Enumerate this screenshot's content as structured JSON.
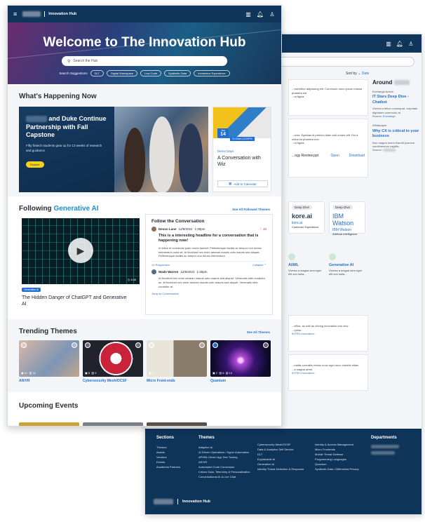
{
  "back": {
    "sort_label": "Sort by",
    "sort_value": "Date",
    "around_title": "Around",
    "around_items": [
      {
        "kicker": "Exchange Article",
        "title": "IT Stars Deep Dive - Chatbot",
        "body": "Viverra a tellus consequat, vulputate dignissim commodo at.",
        "source": "Source:",
        "tag": "Exchange"
      },
      {
        "kicker": "Whitepaper",
        "title": "Why CX is critical to your business",
        "body": "Non magna lorem blandit posuere condimentum sagittis.",
        "source": "Source:",
        "tag": ""
      }
    ],
    "feed_text_1": "...nsectetur adipiscing elit. Commodo nunc ipsum massa pharetra est",
    "feed_text_1b": "...ra ligula.",
    "feed_text_2": "...urna. Egestas id pretium diam sed ornare elit. Est a netus sit pharetra non",
    "feed_text_2b": "...ra ligula.",
    "file_name": "...ogy Review.ppt",
    "file_open": "Open",
    "file_download": "Download",
    "vendors": [
      {
        "pill": "Deep Dive",
        "logo": "kore.ai",
        "name": "kore.ai",
        "desc": "Customer Experience"
      },
      {
        "pill": "Deep Dive",
        "logo": "IBM Watson",
        "name": "IBM Watson",
        "desc": "Artificial Intelligence"
      }
    ],
    "services": [
      {
        "title": "AI/ML",
        "body": "Viverra a magna sem eget elit orci nulla..."
      },
      {
        "title": "Generative AI",
        "body": "Viverra a magna sem eget elit orci nulla..."
      }
    ],
    "feed_text_3": "...effort, as well as driving innovation into new",
    "feed_text_3b": "...rprise.",
    "feed_text_3c": "INTRO innovation...",
    "feed_text_4": "...mallis convallis metus nunc eget nunc lobortis etiam",
    "feed_text_4b": "...a magna amet.",
    "feed_text_4c": "INTRO innovation...",
    "footer": {
      "sections_title": "Sections",
      "sections": [
        "Themes",
        "Assets",
        "Vendors",
        "Events",
        "Academia Partners"
      ],
      "themes_title": "Themes",
      "themes_col1": [
        "Adaptive AI",
        "AI Driven Operations / Hyper Automation",
        "API/ML Driven App Dev Tooling",
        "AR/VR",
        "Automated Code Conversion",
        "Citizen Data, Telemetry & Personalization",
        "Conversational AI & Live Chat"
      ],
      "themes_col2": [
        "Cybersecurity Mesh/OCSF",
        "Data & Analytics Self Service",
        "DLT",
        "Explainable AI",
        "Generative AI",
        "Identity Threat Detection & Response"
      ],
      "themes_col3": [
        "Identity & Access Management",
        "Micro Frontends",
        "Mobile Threat Defense",
        "Programming Languages",
        "Quantum",
        "Synthetic Data / Differential Privacy"
      ],
      "departments_title": "Departments",
      "brand": "Innovation Hub"
    }
  },
  "front": {
    "brand": "Innovation Hub",
    "hero": {
      "title": "Welcome to The Innovation Hub",
      "search_placeholder": "Search the Hub",
      "suggest_label": "Search Suggestions",
      "chips": [
        "DLT",
        "Digital Workspace",
        "Low Code",
        "Synthetic Data",
        "Immersive Experience"
      ]
    },
    "happening": {
      "title": "What's Happening Now",
      "feature_title": "and Duke Continue Partnership with Fall Capstone",
      "feature_body": "Fifty fintech students gear up for 13 weeks of research and guidance",
      "feature_button": "Explore",
      "event_month": "Jan",
      "event_day": "14",
      "event_time": "11:00am-12:00PM",
      "event_label": "Demo Days",
      "event_title": "A Conversation with Wiz",
      "event_button": "Add to Calendar"
    },
    "following": {
      "title_prefix": "Following",
      "title_topic": "Generative AI",
      "see_all": "See All Followed Themes",
      "video_duration": "3:46",
      "video_tag": "Generative AI",
      "video_title": "The Hidden Danger of ChatGPT and Generative AI",
      "convo_title": "Follow the Conversation",
      "post1_author": "Devon Lane",
      "post1_date": "12/8/2022",
      "post1_time": "1:30pm",
      "post1_likes": "45",
      "post1_headline": "This is a interesting headline for a conversation that is happening now!",
      "post1_body": "In tellus et commodo justo morbi laoreet. Pellentesque facilisi ac tempor non donec elementum nulla sit. At tincidunt nec enim aenean mauris odio mauris sed aliquet. Pellentesque facilisi ac tempor non donec elementum.",
      "responses": "12 Responses",
      "collapse": "Collapse",
      "post2_author": "Wade Warren",
      "post2_date": "12/8/2022",
      "post2_time": "1:30pm",
      "post2_body": "At tincidunt nec enim aenean mauris odio mauris sed aliquet. Venenatis nibh curabitur ac. At tincidunt nec enim aenean mauris odio mauris sed aliquet. Venenatis nibh curabitur at.",
      "jump": "Jump to Conversation"
    },
    "trending": {
      "title": "Trending Themes",
      "see_all": "See All Themes",
      "cards": [
        {
          "name": "AR/VR",
          "c1": "51",
          "c2": "32"
        },
        {
          "name": "Cybersecurity Mesh/OCSF",
          "c1": "8",
          "c2": "9"
        },
        {
          "name": "Micro Front-ends",
          "c1": "4",
          "c2": ""
        },
        {
          "name": "Quantum",
          "c1": "2",
          "c2": "8",
          "c3": "10"
        }
      ]
    },
    "upcoming": {
      "title": "Upcoming Events"
    }
  }
}
